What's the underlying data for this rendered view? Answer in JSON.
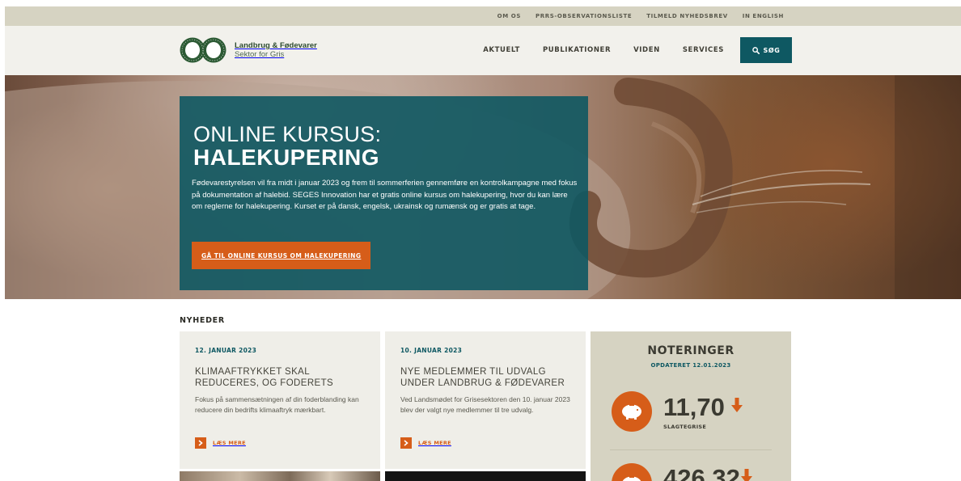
{
  "util_nav": {
    "items": [
      "OM OS",
      "PRRS-OBSERVATIONSLISTE",
      "TILMELD NYHEDSBREV",
      "IN ENGLISH"
    ]
  },
  "logo": {
    "name": "Landbrug & Fødevarer",
    "sub": "Sektor for Gris"
  },
  "main_nav": {
    "items": [
      "AKTUELT",
      "PUBLIKATIONER",
      "VIDEN",
      "SERVICES"
    ],
    "search_label": "SØG"
  },
  "hero": {
    "title_line1": "ONLINE KURSUS:",
    "title_line2": "HALEKUPERING",
    "text": "Fødevarestyrelsen vil fra midt i januar 2023 og frem til sommerferien gennemføre en kontrolkampagne med fokus på dokumentation af halebid. SEGES Innovation har et gratis online kursus om halekupering, hvor du kan lære om reglerne for halekupering. Kurset er på dansk, engelsk, ukrainsk og rumænsk og er gratis at tage.",
    "cta_label": "GÅ TIL ONLINE KURSUS OM HALEKUPERING"
  },
  "news": {
    "heading": "NYHEDER",
    "read_more": "LÆS MERE",
    "cards": [
      {
        "date": "12. JANUAR 2023",
        "title": "KLIMAAFTRYKKET SKAL REDUCERES, OG FODERETS",
        "text": "Fokus på sammensætningen af din foderblanding kan reducere din bedrifts klimaaftryk mærkbart."
      },
      {
        "date": "10. JANUAR 2023",
        "title": "NYE MEDLEMMER TIL UDVALG UNDER LANDBRUG & FØDEVARER",
        "text": "Ved Landsmødet for Grisesektoren den 10. januar 2023 blev der valgt nye medlemmer til tre udvalg."
      }
    ]
  },
  "notes": {
    "title": "NOTERINGER",
    "updated": "OPDATERET 12.01.2023",
    "items": [
      {
        "value": "11,70",
        "label": "SLAGTEGRISE",
        "trend": "down"
      },
      {
        "value": "426,32",
        "label": "",
        "trend": "down"
      }
    ]
  },
  "colors": {
    "teal": "#0e5862",
    "orange": "#d65d19",
    "beige": "#d6d3c2"
  }
}
